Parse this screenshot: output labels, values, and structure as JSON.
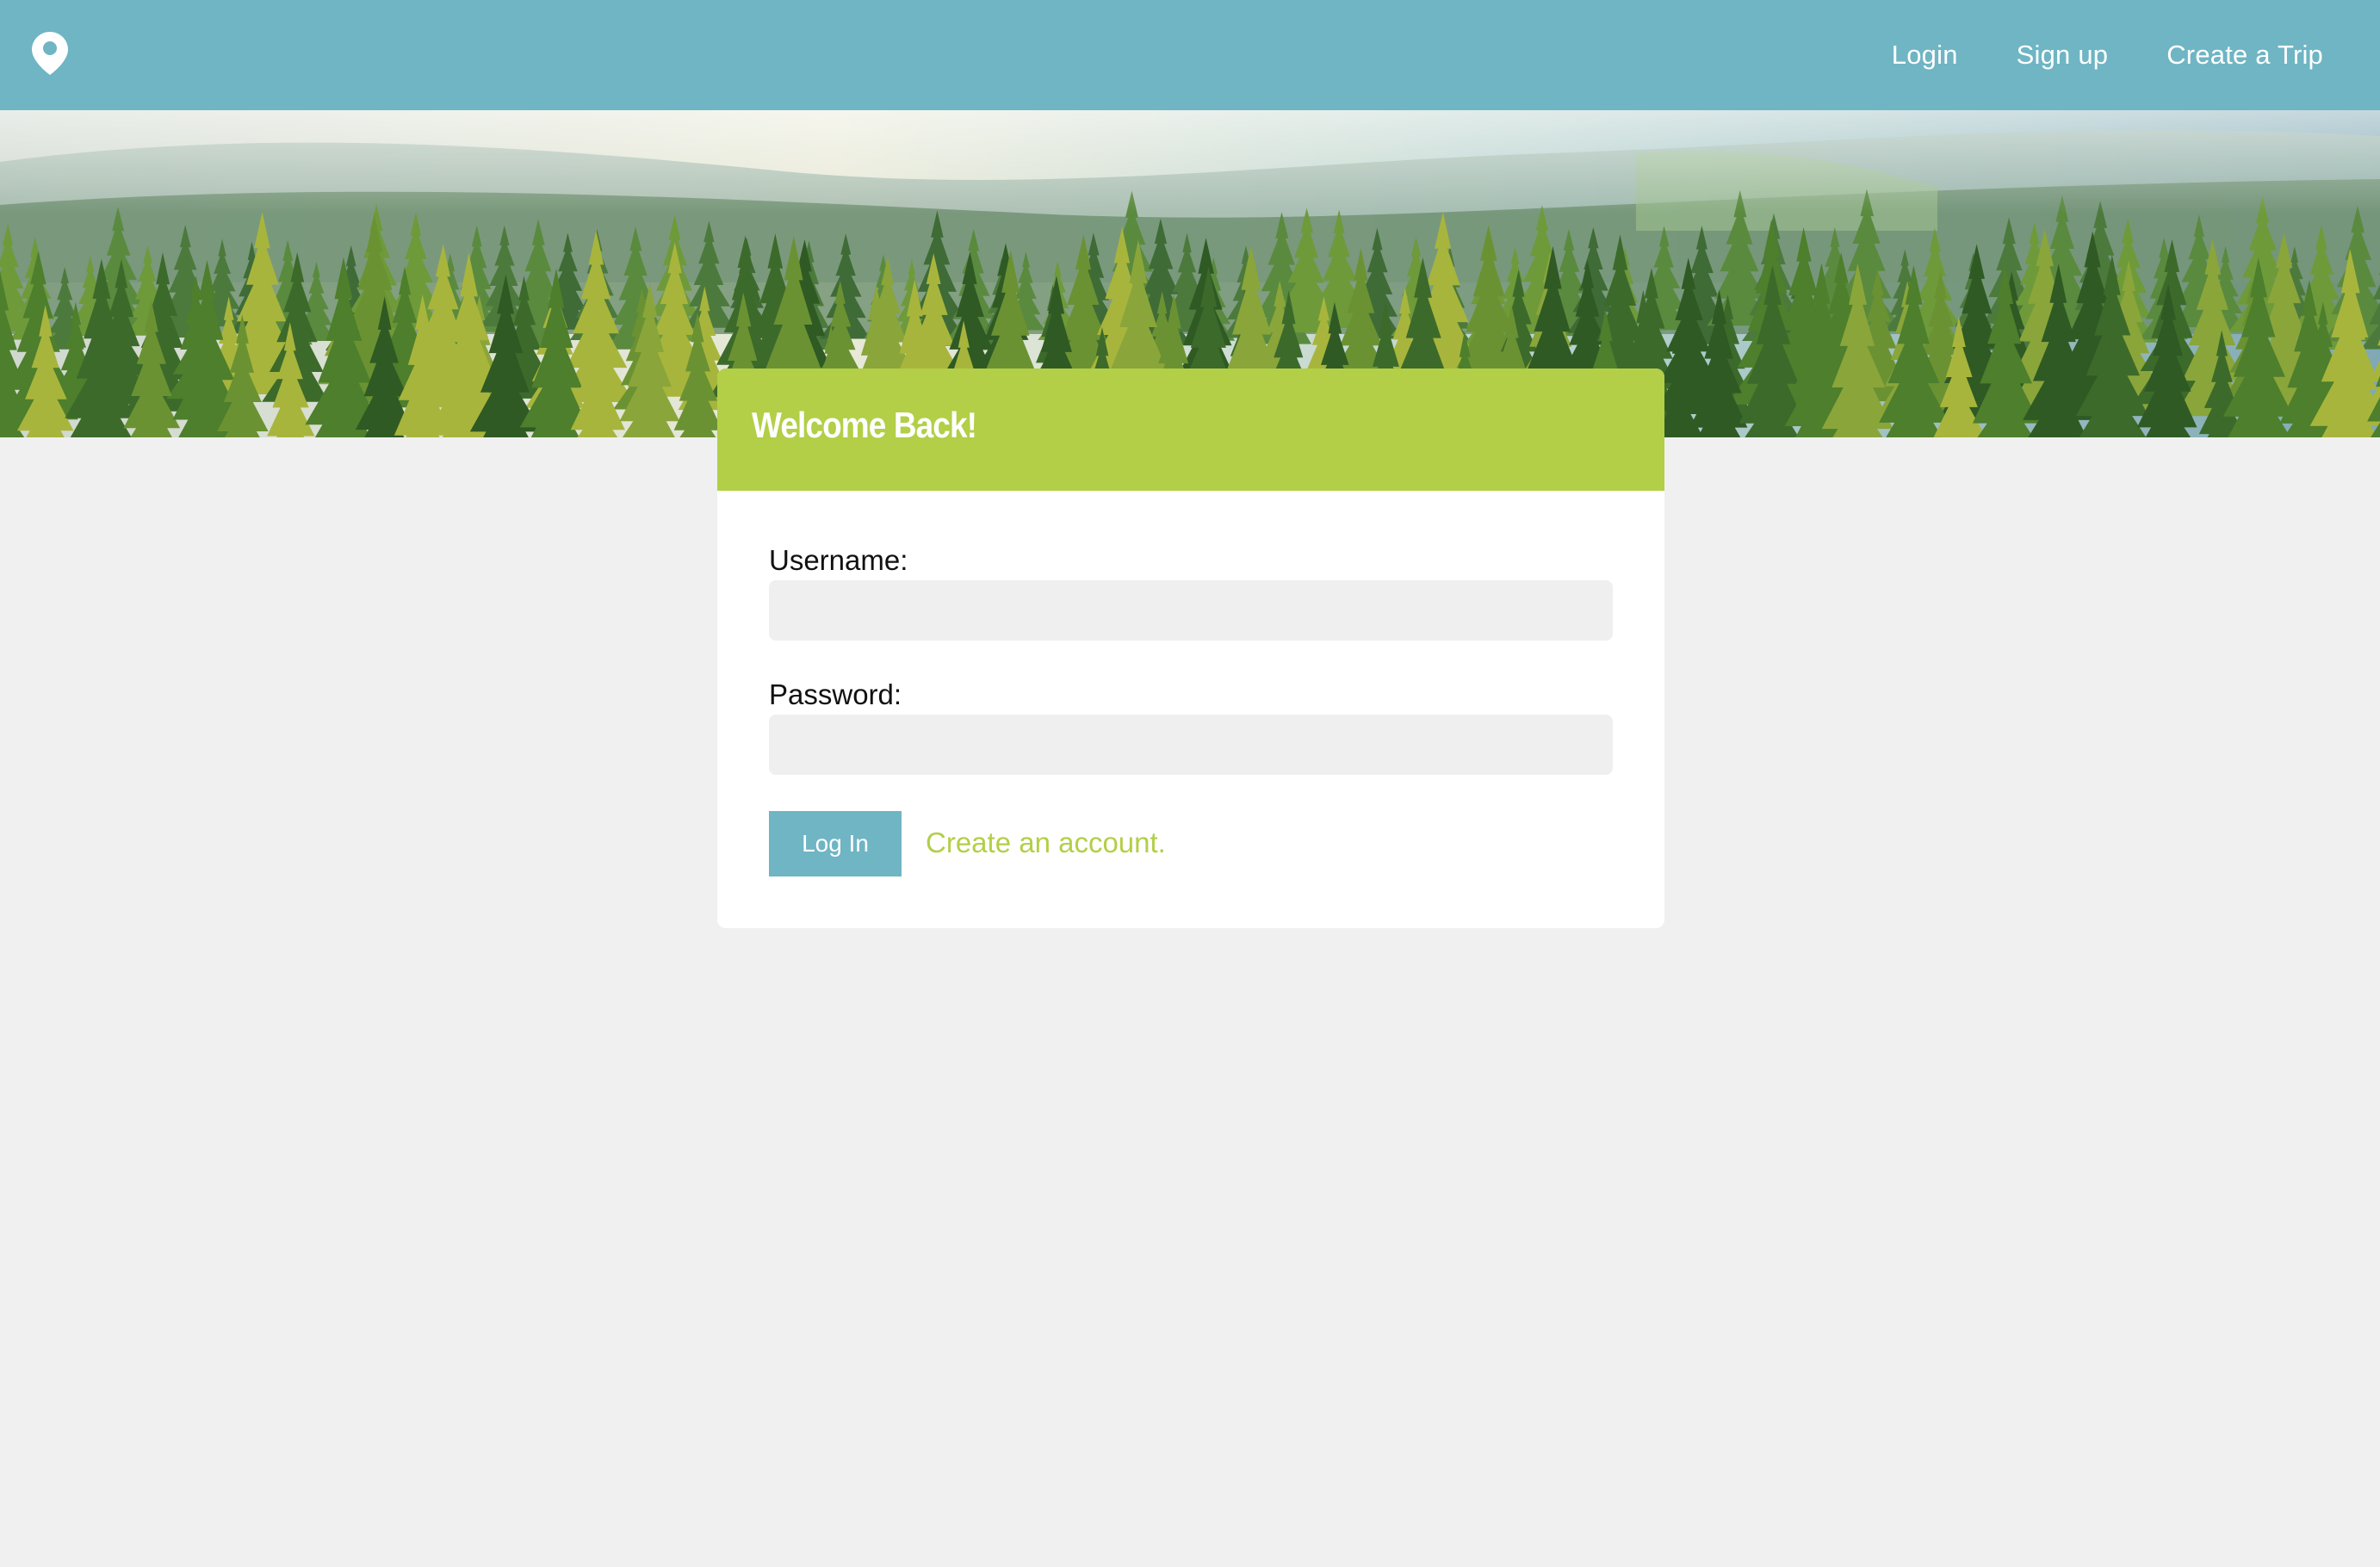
{
  "nav": {
    "logo_icon": "map-pin-icon",
    "links": [
      {
        "label": "Login"
      },
      {
        "label": "Sign up"
      },
      {
        "label": "Create a Trip"
      }
    ]
  },
  "hero": {
    "image": "forest-treetops-banner"
  },
  "login_card": {
    "title": "Welcome Back!",
    "username_label": "Username:",
    "username_value": "",
    "password_label": "Password:",
    "password_value": "",
    "submit_label": "Log In",
    "create_account_label": "Create an account."
  },
  "colors": {
    "nav_background": "#6fb5c4",
    "accent_green": "#b2cf47",
    "page_background": "#f0f0f0",
    "button_background": "#6fb5c4"
  }
}
